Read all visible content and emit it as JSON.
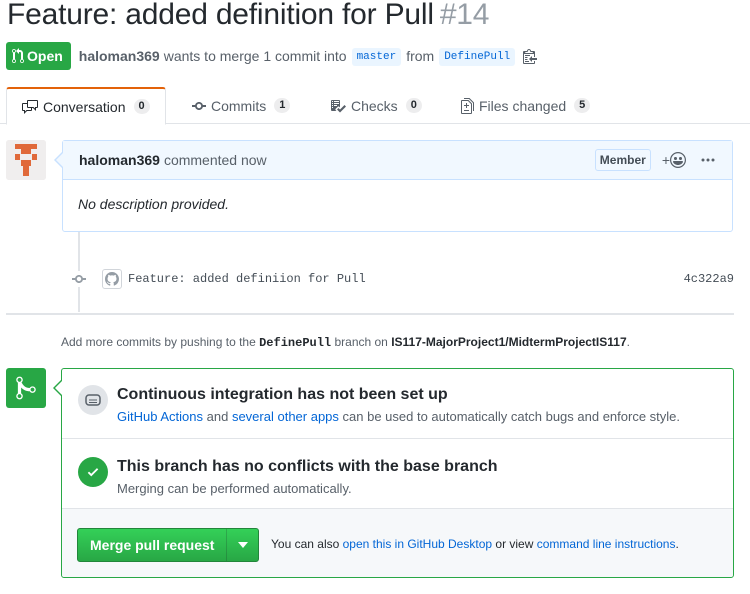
{
  "pr": {
    "title": "Feature: added definition for Pull",
    "number": "#14",
    "state": "Open",
    "author": "haloman369",
    "merge_text": "wants to merge 1 commit into",
    "base_branch": "master",
    "from_text": "from",
    "head_branch": "DefinePull"
  },
  "tabs": [
    {
      "label": "Conversation",
      "count": "0",
      "icon": "comment-discussion-icon"
    },
    {
      "label": "Commits",
      "count": "1",
      "icon": "git-commit-icon"
    },
    {
      "label": "Checks",
      "count": "0",
      "icon": "checklist-icon"
    },
    {
      "label": "Files changed",
      "count": "5",
      "icon": "file-diff-icon"
    }
  ],
  "comment": {
    "author": "haloman369",
    "action": "commented now",
    "badge": "Member",
    "reaction_plus": "+",
    "body": "No description provided."
  },
  "commit": {
    "message": "Feature: added definiion for Pull",
    "sha": "4c322a9"
  },
  "push_hint": {
    "prefix": "Add more commits by pushing to the",
    "branch": "DefinePull",
    "mid": "branch on",
    "repo": "IS117-MajorProject1/MidtermProjectIS117",
    "suffix": "."
  },
  "merge": {
    "ci_title": "Continuous integration has not been set up",
    "ci_link1": "GitHub Actions",
    "ci_and": "and",
    "ci_link2": "several other apps",
    "ci_rest": "can be used to automatically catch bugs and enforce style.",
    "conflict_title": "This branch has no conflicts with the base branch",
    "conflict_sub": "Merging can be performed automatically.",
    "button": "Merge pull request",
    "also_prefix": "You can also",
    "also_link1": "open this in GitHub Desktop",
    "also_mid": "or view",
    "also_link2": "command line instructions",
    "also_suffix": "."
  },
  "colors": {
    "green": "#28a745",
    "link": "#0366d6",
    "tab_accent": "#e36209",
    "comment_header": "#f1f8ff"
  }
}
